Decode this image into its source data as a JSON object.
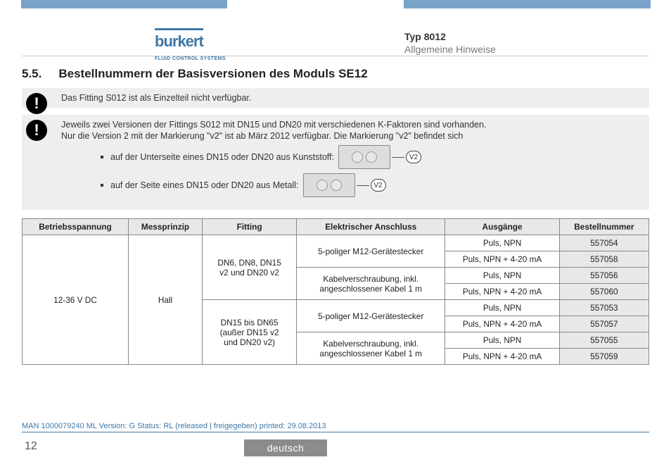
{
  "header": {
    "logo_text": "burkert",
    "logo_sub": "FLUID CONTROL SYSTEMS",
    "typ": "Typ 8012",
    "subtitle": "Allgemeine Hinweise"
  },
  "section": {
    "number": "5.5.",
    "title": "Bestellnummern der Basisversionen des Moduls SE12"
  },
  "notice1": "Das Fitting S012 ist als Einzelteil nicht verfügbar.",
  "notice2_line1": "Jeweils zwei Versionen der Fittings S012 mit DN15 und DN20 mit verschiedenen K-Faktoren sind vorhanden.",
  "notice2_line2": "Nur die Version 2 mit der Markierung \"v2\" ist ab März 2012 verfügbar. Die Markierung \"v2\" befindet sich",
  "bullet1": "auf der Unterseite eines DN15 oder DN20 aus Kunststoff:",
  "bullet2": "auf der Seite eines DN15 oder DN20 aus Metall:",
  "v2_badge": "V2",
  "table": {
    "headers": {
      "h1": "Betriebsspannung",
      "h2": "Messprinzip",
      "h3": "Fitting",
      "h4": "Elektrischer Anschluss",
      "h5": "Ausgänge",
      "h6": "Bestellnummer"
    },
    "betr": "12-36 V DC",
    "mess": "Hall",
    "fitting1_l1": "DN6, DN8, DN15",
    "fitting1_l2": "v2 und DN20 v2",
    "fitting2_l1": "DN15 bis DN65",
    "fitting2_l2": "(außer DN15 v2",
    "fitting2_l3": "und DN20 v2)",
    "conn1": "5-poliger M12-Gerätestecker",
    "conn2_l1": "Kabelverschraubung, inkl.",
    "conn2_l2": "angeschlossener Kabel 1 m",
    "out_pn": "Puls, NPN",
    "out_pn420": "Puls, NPN + 4-20 mA",
    "bn": {
      "r1": "557054",
      "r2": "557058",
      "r3": "557056",
      "r4": "557060",
      "r5": "557053",
      "r6": "557057",
      "r7": "557055",
      "r8": "557059"
    }
  },
  "footer": {
    "meta": "MAN 1000079240 ML Version: G Status: RL (released | freigegeben) printed: 29.08.2013",
    "page": "12",
    "lang": "deutsch"
  }
}
